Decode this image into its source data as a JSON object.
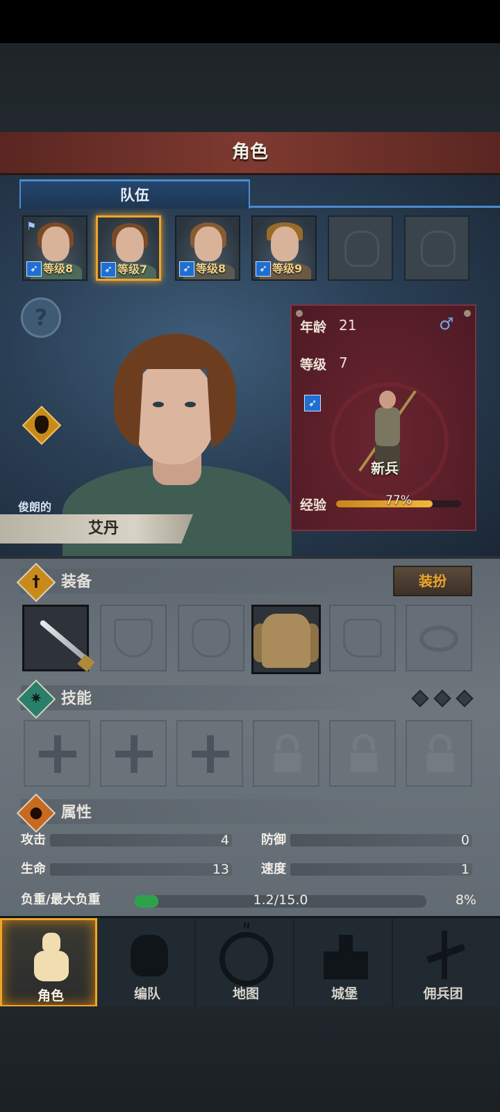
{
  "header": {
    "title": "角色"
  },
  "team": {
    "tab_label": "队伍",
    "members": [
      {
        "level_text": "等级8",
        "leader": true,
        "selected": false
      },
      {
        "level_text": "等级7",
        "leader": false,
        "selected": true
      },
      {
        "level_text": "等级8",
        "leader": false,
        "selected": false
      },
      {
        "level_text": "等级9",
        "leader": false,
        "selected": false
      }
    ],
    "empty_slots": 2
  },
  "hero": {
    "help_glyph": "?",
    "trait": "俊朗的",
    "name": "艾丹",
    "age_label": "年龄",
    "age": "21",
    "gender_glyph": "♂",
    "level_label": "等级",
    "level": "7",
    "class_name": "新兵",
    "xp_label": "经验",
    "xp_percent": 77,
    "xp_text": "77%"
  },
  "equipment": {
    "title": "装备",
    "dress_button": "装扮",
    "slots": [
      "sword",
      "shield",
      "helmet",
      "tunic",
      "boots",
      "ring"
    ]
  },
  "skills": {
    "title": "技能",
    "unlocked": 3,
    "locked": 3,
    "gems": 3
  },
  "attributes": {
    "title": "属性",
    "attack_label": "攻击",
    "attack": "4",
    "defense_label": "防御",
    "defense": "0",
    "hp_label": "生命",
    "hp": "13",
    "speed_label": "速度",
    "speed": "1",
    "load_label": "负重/最大负重",
    "load_text": "1.2/15.0",
    "load_percent_text": "8%",
    "load_fraction": 0.08
  },
  "nav": {
    "items": [
      {
        "label": "角色",
        "active": true
      },
      {
        "label": "编队",
        "active": false
      },
      {
        "label": "地图",
        "active": false
      },
      {
        "label": "城堡",
        "active": false
      },
      {
        "label": "佣兵团",
        "active": false
      }
    ],
    "map_north": "N"
  },
  "colors": {
    "accent": "#f0a429",
    "team_tab": "#4b8cd0",
    "banner": "#7e3a30",
    "info_card": "#5a1f29",
    "load_bar": "#2ea24a"
  }
}
